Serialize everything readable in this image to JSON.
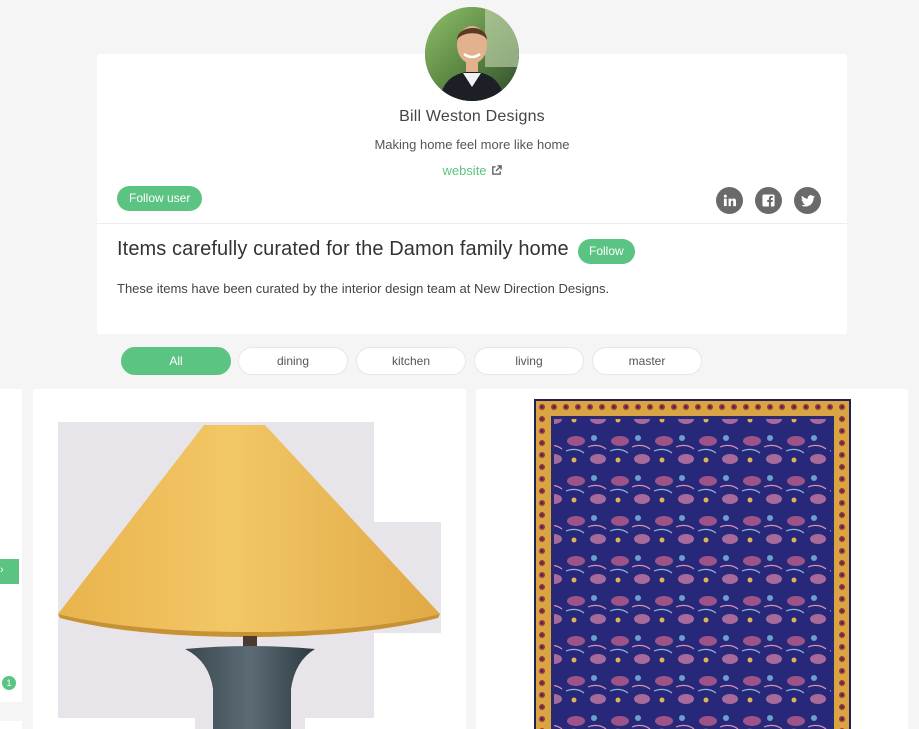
{
  "profile": {
    "name": "Bill Weston Designs",
    "tagline": "Making home feel more like home",
    "website_label": "website",
    "follow_user_label": "Follow user",
    "social": [
      "linkedin-icon",
      "facebook-icon",
      "twitter-icon"
    ]
  },
  "collection": {
    "title": "Items carefully curated for the Damon family home",
    "follow_label": "Follow",
    "description": "These items have been curated by the interior design team at New Direction Designs."
  },
  "filters": {
    "tabs": [
      "All",
      "dining",
      "kitchen",
      "living",
      "master"
    ],
    "active": "All"
  },
  "side_card": {
    "tag_text": "›",
    "badge_count": "1"
  },
  "products": [
    {
      "name": "lamp",
      "image": "table-lamp-image"
    },
    {
      "name": "rug",
      "image": "persian-rug-image"
    }
  ],
  "colors": {
    "accent": "#5bc482",
    "background": "#f5f5f5",
    "card": "#ffffff",
    "social_icon_bg": "#6a6a6a"
  }
}
